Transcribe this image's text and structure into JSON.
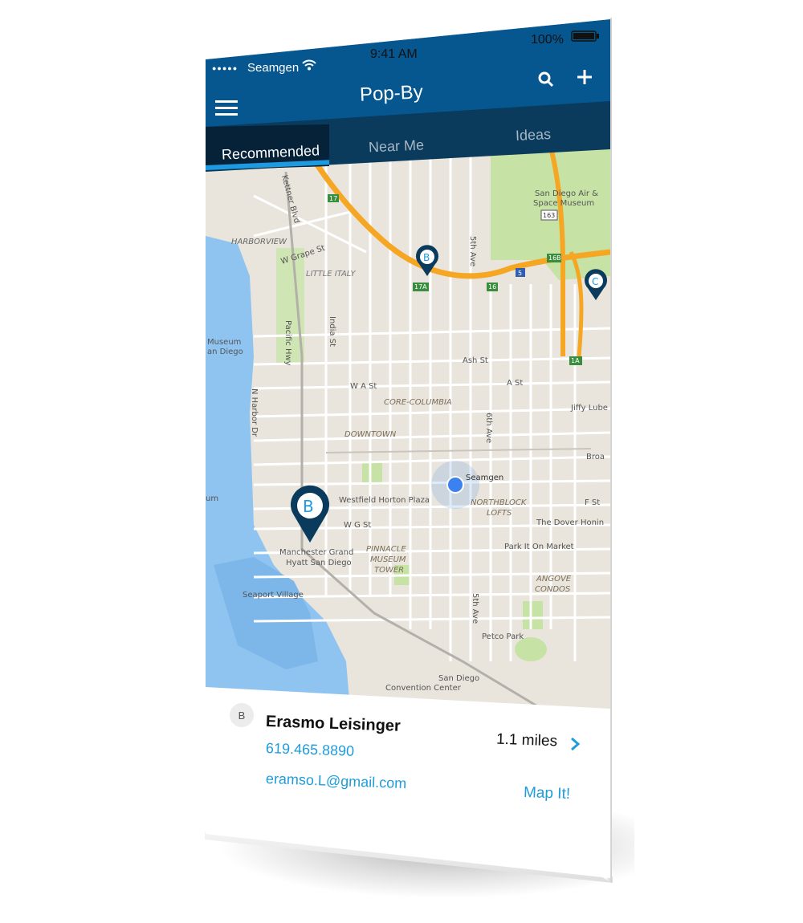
{
  "status_bar": {
    "signal_dots": "●●●●●",
    "carrier": "Seamgen",
    "time": "9:41 AM",
    "battery": "100%"
  },
  "nav": {
    "title": "Pop-By",
    "menu_icon": "menu-icon",
    "search_icon": "search-icon",
    "add_icon": "add-icon"
  },
  "tabs": [
    {
      "label": "Recommended",
      "active": true
    },
    {
      "label": "Near Me",
      "active": false
    },
    {
      "label": "Ideas",
      "active": false
    }
  ],
  "map": {
    "markers": [
      {
        "letter": "B",
        "label": "small-b"
      },
      {
        "letter": "C",
        "label": "small-c"
      },
      {
        "letter": "B",
        "label": "large-b"
      }
    ],
    "current_location_label": "Seamgen",
    "labels": {
      "harborview": "HARBORVIEW",
      "w_grape_st": "W Grape St",
      "little_italy": "LITTLE ITALY",
      "kettner_blvd": "Kettner Blvd",
      "fifth_ave_top": "5th Ave",
      "san_diego_air": "San Diego Air &",
      "space_museum": "Space Museum",
      "museum": "Museum",
      "an_diego": "an Diego",
      "pacific_hwy": "Pacific Hwy",
      "india_st": "India St",
      "ash_st": "Ash St",
      "w_a_st": "W A St",
      "a_st": "A St",
      "core_columbia": "CORE-COLUMBIA",
      "jiffy_lube": "Jiffy Lube",
      "n_harbor_dr": "N Harbor Dr",
      "downtown": "DOWNTOWN",
      "sixth_ave": "6th Ave",
      "broa": "Broa",
      "um": "um",
      "westfield": "Westfield Horton Plaza",
      "northblock": "NORTHBLOCK",
      "lofts": "LOFTS",
      "f_st": "F St",
      "w_g_st": "W G St",
      "dover": "The Dover Honin",
      "manchester1": "Manchester Grand",
      "manchester2": "Hyatt San Diego",
      "pinnacle1": "PINNACLE",
      "pinnacle2": "MUSEUM",
      "pinnacle3": "TOWER",
      "park_it": "Park It On Market",
      "angove": "ANGOVE",
      "condos": "CONDOS",
      "seaport": "Seaport Village",
      "fifth_ave_bottom": "5th Ave",
      "petco": "Petco Park",
      "sd1": "San Diego",
      "sd2": "Convention Center",
      "hwy_17": "17",
      "hwy_163": "163",
      "hwy_16b": "16B",
      "hwy_5": "5",
      "hwy_17a": "17A",
      "hwy_16": "16",
      "hwy_1a": "1A"
    }
  },
  "card": {
    "avatar_letter": "B",
    "name": "Erasmo Leisinger",
    "phone": "619.465.8890",
    "email": "eramso.L@gmail.com",
    "distance": "1.1 miles",
    "action": "Map It!"
  },
  "colors": {
    "nav_blue": "#06578f",
    "tab_dark": "#0a3a5c",
    "tab_active": "#062238",
    "accent": "#1f9cdb",
    "highway": "#f5a623",
    "water": "#8fc3f0",
    "park": "#c6e2a4",
    "land": "#e9e5dc"
  }
}
